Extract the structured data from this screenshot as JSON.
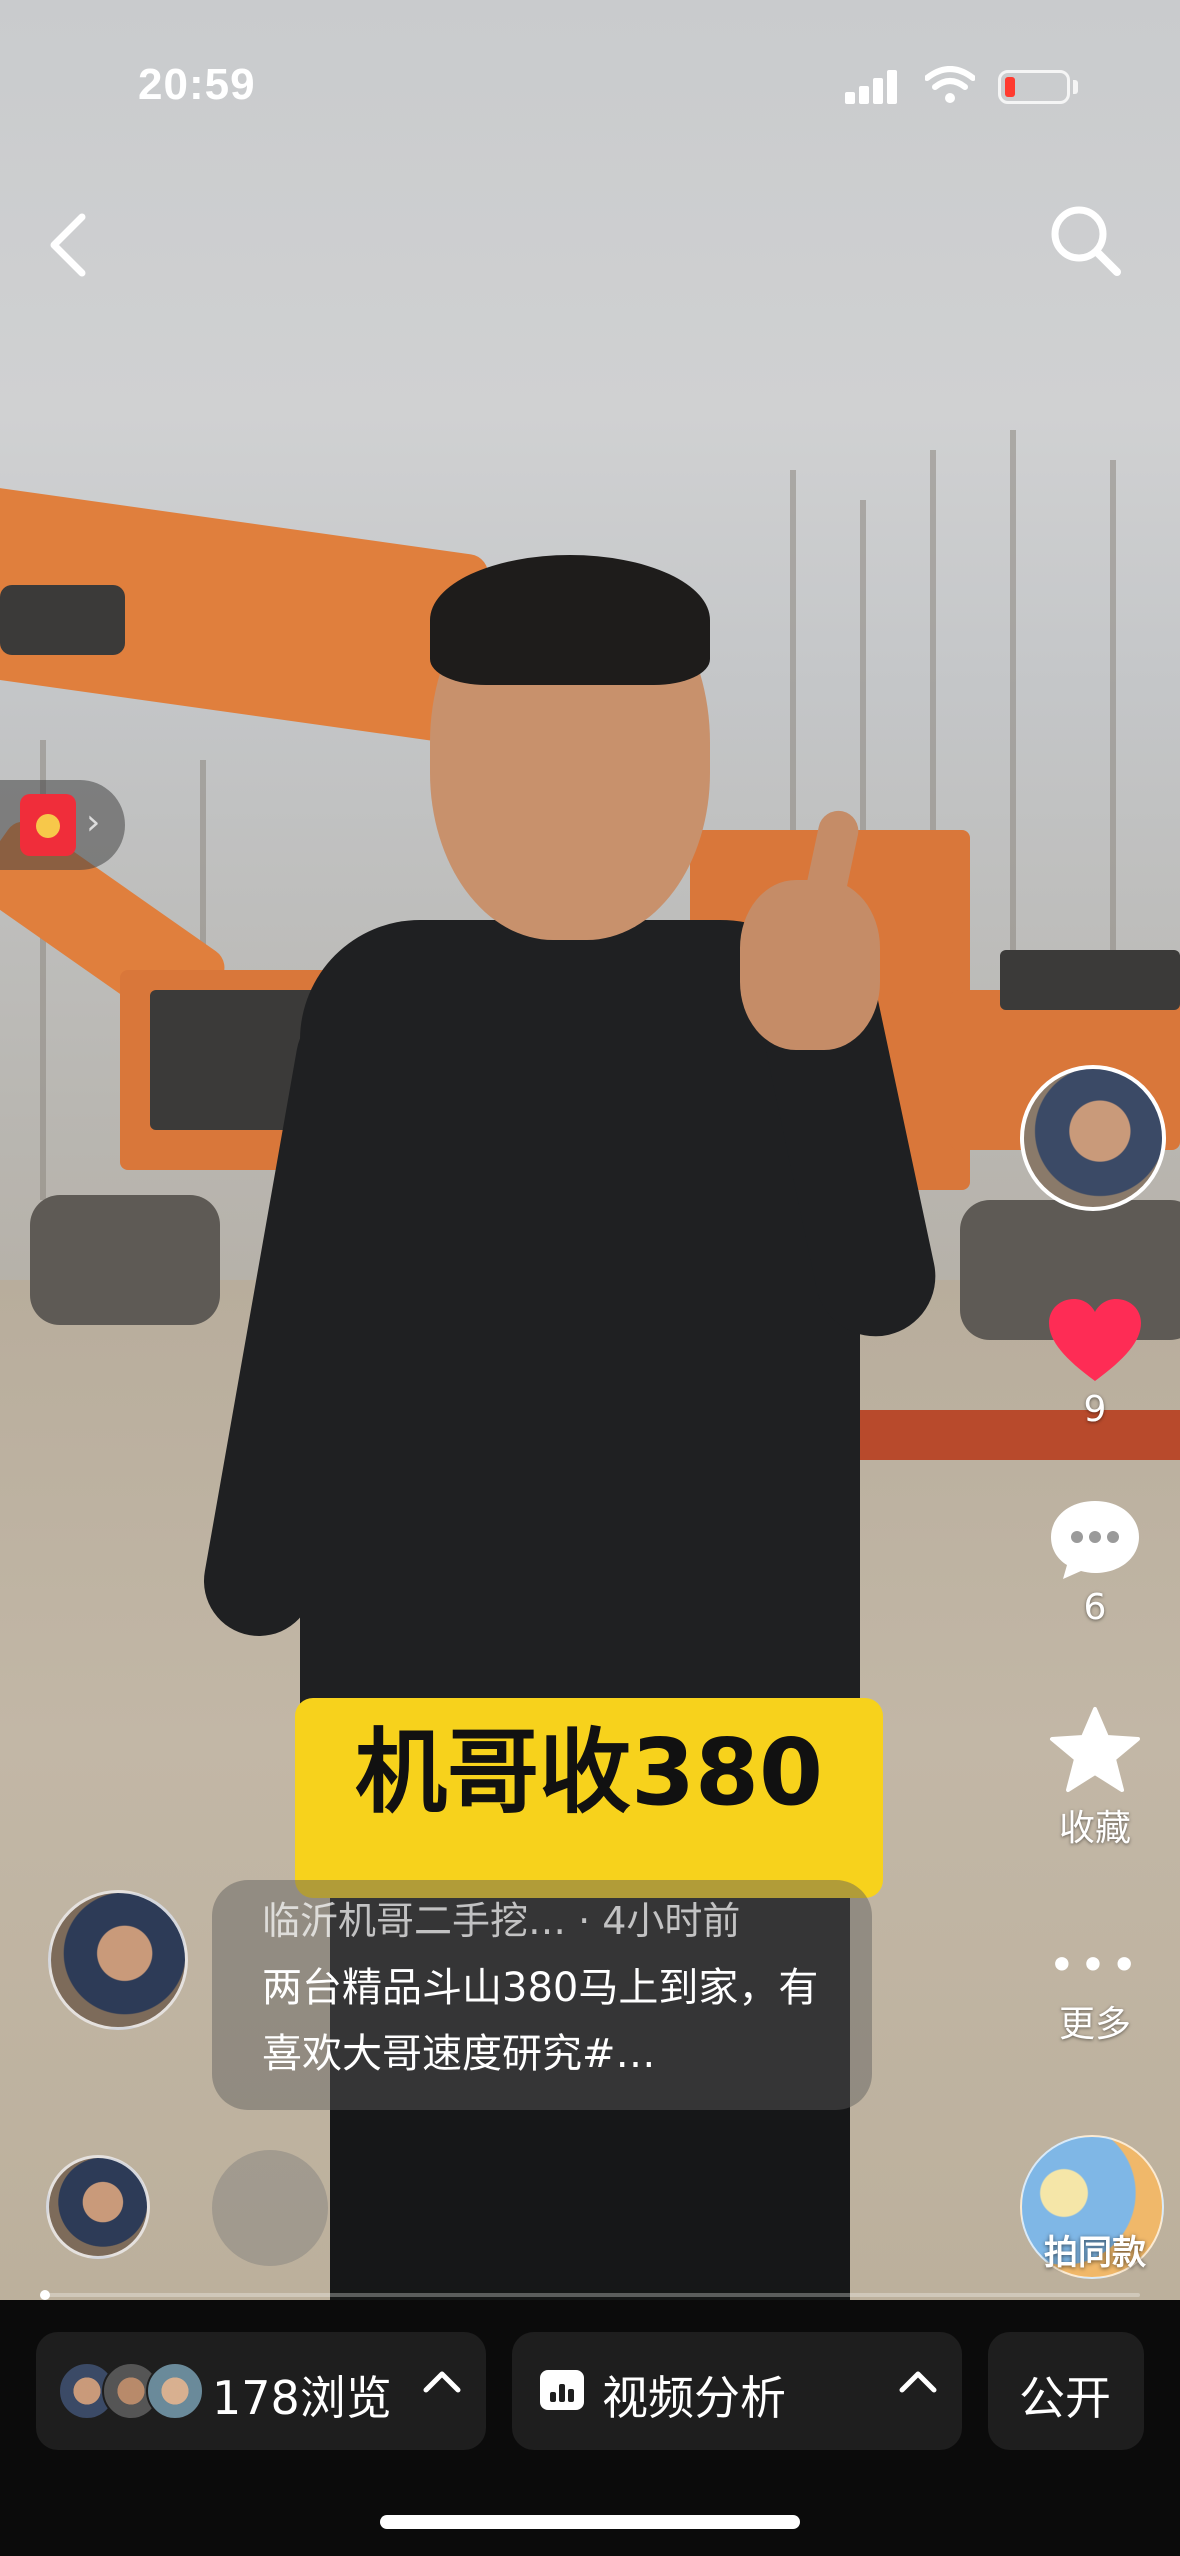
{
  "status_bar": {
    "time": "20:59"
  },
  "nav": {
    "back_icon": "chevron-left-icon",
    "search_icon": "search-icon"
  },
  "overlay": {
    "caption": "机哥收380"
  },
  "post": {
    "author_time": "临沂机哥二手挖… · 4小时前",
    "text": "两台精品斗山380马上到家，有喜欢大哥速度研究#…"
  },
  "actions": {
    "like_count": "9",
    "comment_count": "6",
    "favorite_label": "收藏",
    "more_label": "更多",
    "same_style_label": "拍同款",
    "heart_color": "#fe2c55"
  },
  "bottom_bar": {
    "views_label": "178浏览",
    "analysis_label": "视频分析",
    "public_label": "公开"
  }
}
